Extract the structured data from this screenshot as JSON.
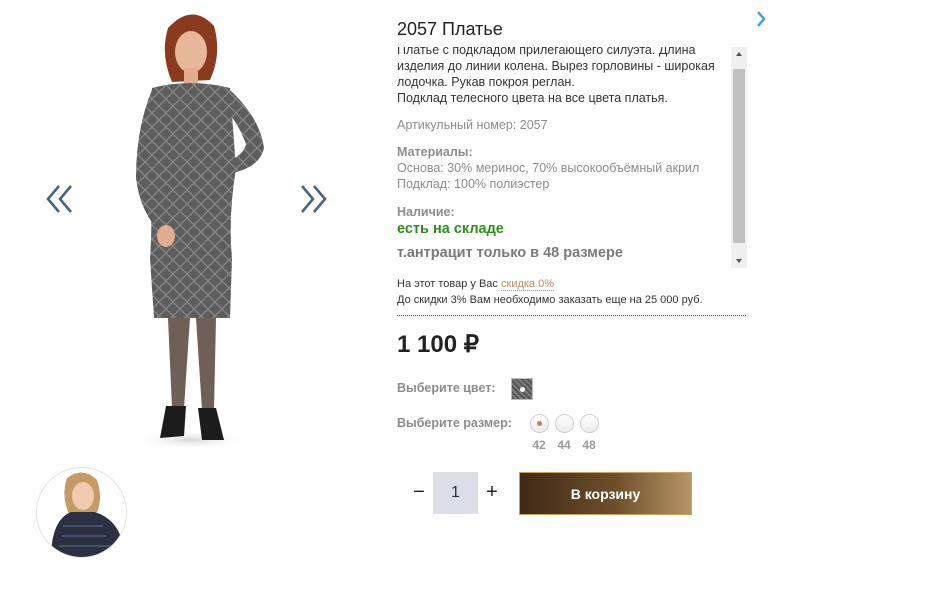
{
  "product": {
    "title": "2057 Платье",
    "description_lines": [
      "Платье с подкладом прилегающего силуэта. Длина",
      "изделия до линии колена. Вырез горловины - широкая",
      "лодочка. Рукав покроя реглан.",
      "Подклад телесного цвета на все цвета платья."
    ],
    "article_label": "Артикульный номер: 2057",
    "materials_label": "Материалы:",
    "materials_lines": [
      "Основа: 30% меринос, 70% высокообъёмный акрил",
      "Подклад: 100% полиэстер"
    ],
    "availability_label": "Наличие:",
    "availability_value": "есть на складе",
    "stock_note": "т.антрацит только в 48 размере"
  },
  "discount": {
    "line1_prefix": "На этот товар у Вас",
    "line1_link": "скидка 0%",
    "line2": "До скидки 3% Вам необходимо заказать еще на 25 000 руб."
  },
  "price": "1 100 ₽",
  "color": {
    "label": "Выберите цвет:"
  },
  "size": {
    "label": "Выберите размер:",
    "options": [
      "42",
      "44",
      "48"
    ],
    "selected": "42"
  },
  "cart": {
    "quantity": "1",
    "minus": "−",
    "plus": "+",
    "button_label": "В корзину"
  },
  "icons": {
    "prev": "double-chevron-left-icon",
    "next": "double-chevron-right-icon",
    "next_product": "chevron-right-icon"
  },
  "colors": {
    "accent_blue": "#3b7fbf",
    "in_stock_green": "#2f8f1a",
    "link_brown": "#c08a5a",
    "button_dark": "#3f2a16",
    "button_light": "#b69565"
  }
}
